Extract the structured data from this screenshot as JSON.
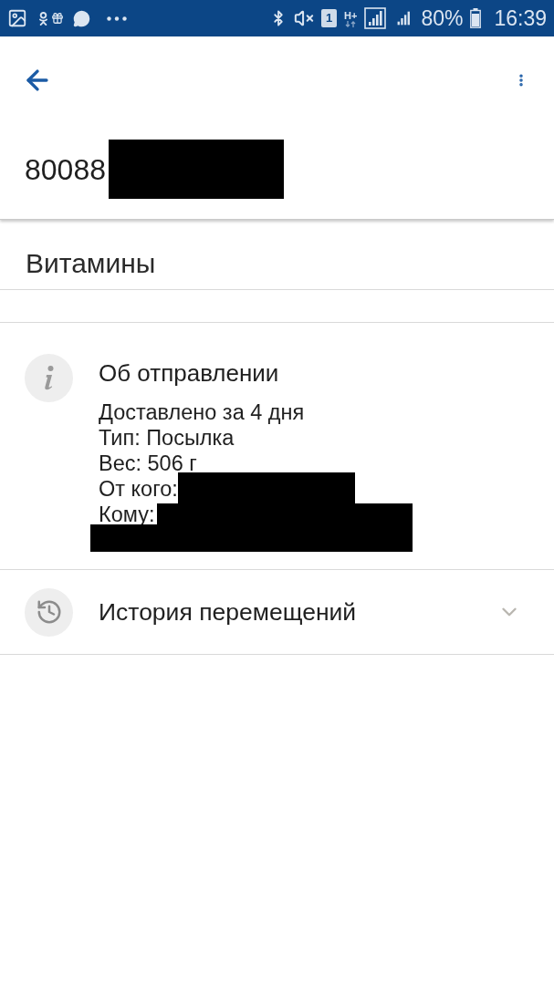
{
  "status_bar": {
    "sim": "1",
    "network": "H+",
    "battery": "80%",
    "time": "16:39"
  },
  "tracking_number": {
    "text": "80088",
    "redacted": true
  },
  "name": "Витамины",
  "sections": [
    {
      "kind": "info",
      "title": "Об отправлении",
      "lines": [
        {
          "text": "Доставлено за 4 дня",
          "redacted": false
        },
        {
          "text": "Тип: Посылка",
          "redacted": false
        },
        {
          "text": "Вес: 506 г",
          "redacted": false
        },
        {
          "text": "От кого:",
          "redacted": true
        },
        {
          "text": "Кому:",
          "redacted": true
        }
      ]
    },
    {
      "kind": "history",
      "title": "История перемещений",
      "expanded": false
    }
  ]
}
